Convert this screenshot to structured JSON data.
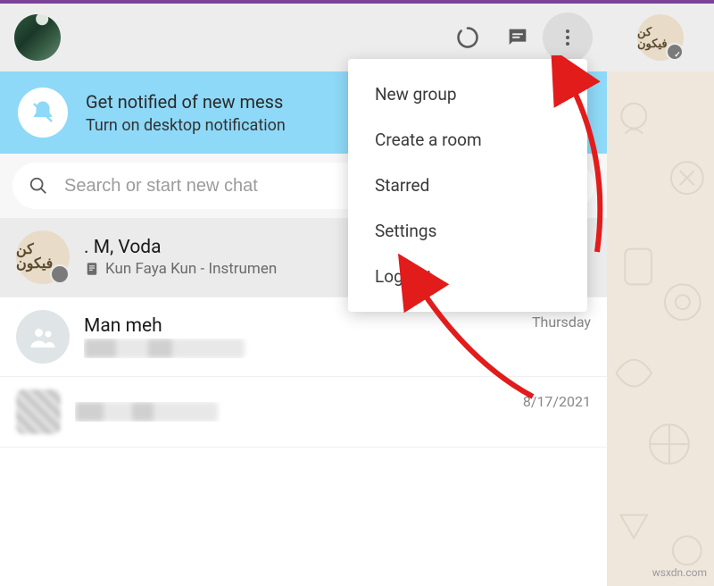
{
  "header": {
    "status_icon": "status-ring",
    "chat_icon": "chat-bubble",
    "menu_icon": "vertical-dots"
  },
  "notification": {
    "title": "Get notified of new mess",
    "subtitle": "Turn on desktop notification"
  },
  "search": {
    "placeholder": "Search or start new chat"
  },
  "chats": [
    {
      "name": ". M, Voda",
      "message": "Kun Faya Kun - Instrumen",
      "time": "",
      "avatar_text": "كن فيكون"
    },
    {
      "name": "Man meh",
      "message": "",
      "time": "Thursday",
      "avatar_text": ""
    },
    {
      "name": "",
      "message": "",
      "time": "8/17/2021",
      "avatar_text": ""
    }
  ],
  "menu": {
    "items": [
      "New group",
      "Create a room",
      "Starred",
      "Settings",
      "Log out"
    ]
  },
  "side_avatar_text": "كن فيكون",
  "watermark": "wsxdn.com"
}
